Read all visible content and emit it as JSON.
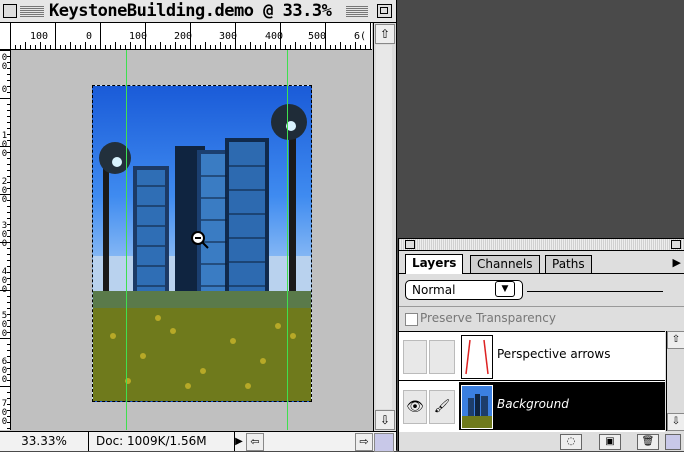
{
  "document": {
    "title": "KeystoneBuilding.demo @ 33.3%",
    "ruler_top_labels": [
      "100",
      "0",
      "100",
      "200",
      "300",
      "400",
      "500",
      "6("
    ],
    "ruler_left_labels": [
      "0\n0",
      "0",
      "1\n0\n0",
      "2\n0\n0",
      "3\n0\n0",
      "4\n0\n0",
      "5\n0\n0",
      "6\n0\n0",
      "7\n0\n0"
    ],
    "zoom_level": "33.33%",
    "doc_size": "Doc: 1009K/1.56M"
  },
  "layers_palette": {
    "tabs": [
      "Layers",
      "Channels",
      "Paths"
    ],
    "active_tab": "Layers",
    "blend_mode": "Normal",
    "preserve_transparency_label": "Preserve Transparency",
    "preserve_transparency_checked": false,
    "layers": [
      {
        "name": "Perspective arrows",
        "visible": false,
        "selected": false
      },
      {
        "name": "Background",
        "visible": true,
        "selected": true
      }
    ]
  },
  "icons": {
    "eye": "eye-icon",
    "brush": "paintbrush-icon",
    "zoom_out_cursor": "zoom-out-cursor-icon",
    "new_layer_mask": "layer-mask-icon",
    "new_layer": "new-layer-icon",
    "trash": "trash-icon"
  },
  "colors": {
    "guide": "#3fe04f",
    "desktop": "#4a4a4a",
    "selected_layer": "#000000"
  }
}
